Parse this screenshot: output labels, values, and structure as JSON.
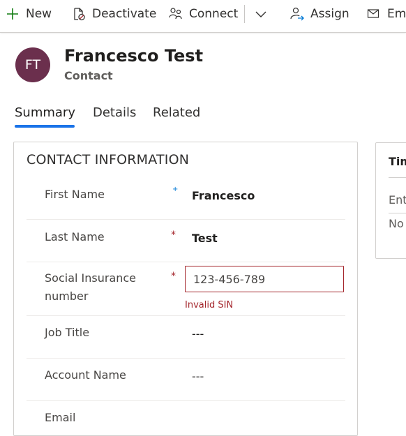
{
  "command_bar": {
    "new": "New",
    "deactivate": "Deactivate",
    "connect": "Connect",
    "assign": "Assign",
    "email": "Ema"
  },
  "record": {
    "initials": "FT",
    "title": "Francesco Test",
    "entity": "Contact"
  },
  "tabs": [
    {
      "label": "Summary",
      "active": true
    },
    {
      "label": "Details",
      "active": false
    },
    {
      "label": "Related",
      "active": false
    }
  ],
  "section": {
    "title": "CONTACT INFORMATION",
    "fields": {
      "first_name": {
        "label": "First Name",
        "value": "Francesco",
        "marker": "+"
      },
      "last_name": {
        "label": "Last Name",
        "value": "Test",
        "marker": "*"
      },
      "sin": {
        "label_line1": "Social Insurance",
        "label_line2": "number",
        "value": "123-456-789",
        "marker": "*",
        "error": "Invalid SIN"
      },
      "job_title": {
        "label": "Job Title",
        "value": "---"
      },
      "account_name": {
        "label": "Account Name",
        "value": "---"
      },
      "email": {
        "label": "Email"
      }
    }
  },
  "side_panel": {
    "title": "Tim",
    "line1": "Ent",
    "line2": "No"
  },
  "colors": {
    "avatar": "#6b2f4d",
    "accent": "#1a73e8",
    "error": "#a4262c",
    "icon_green": "#107c10"
  }
}
